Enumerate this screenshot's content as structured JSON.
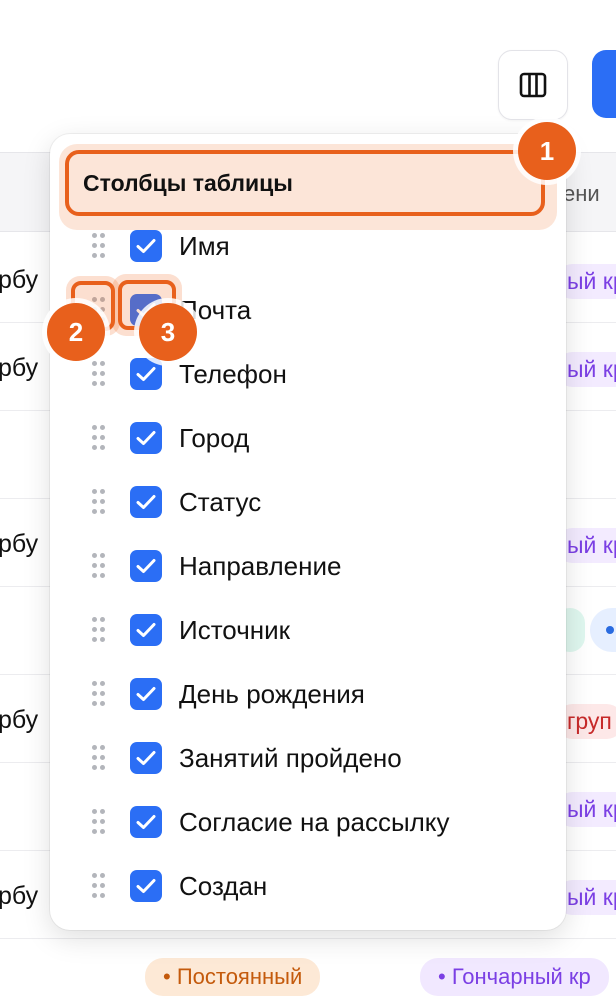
{
  "toolbar": {
    "columns_icon": "columns-icon",
    "accent": "#2b6ef5"
  },
  "table": {
    "header_right": "ени",
    "rows": [
      {
        "left": "рбу",
        "tag": "ый кр"
      },
      {
        "left": "рбу",
        "tag": "ый кр"
      },
      {
        "left": "",
        "tag": ""
      },
      {
        "left": "рбу",
        "tag": "ый кр"
      },
      {
        "left": "",
        "tag": ""
      },
      {
        "left": "рбу",
        "tag": "груп"
      },
      {
        "left": "",
        "tag": "ый кр"
      },
      {
        "left": "рбу",
        "tag": "ый кр"
      }
    ],
    "bottom_tags": [
      "• Постоянный",
      "• Гончарный кр"
    ]
  },
  "dropdown": {
    "title": "Столбцы таблицы",
    "options": [
      {
        "label": "Имя",
        "checked": true
      },
      {
        "label": "Почта",
        "checked": true
      },
      {
        "label": "Телефон",
        "checked": true
      },
      {
        "label": "Город",
        "checked": true
      },
      {
        "label": "Статус",
        "checked": true
      },
      {
        "label": "Направление",
        "checked": true
      },
      {
        "label": "Источник",
        "checked": true
      },
      {
        "label": "День рождения",
        "checked": true
      },
      {
        "label": "Занятий пройдено",
        "checked": true
      },
      {
        "label": "Согласие на рассылку",
        "checked": true
      },
      {
        "label": "Создан",
        "checked": true
      }
    ]
  },
  "annotations": {
    "badge_1": "1",
    "badge_2": "2",
    "badge_3": "3",
    "color": "#e8601c"
  }
}
